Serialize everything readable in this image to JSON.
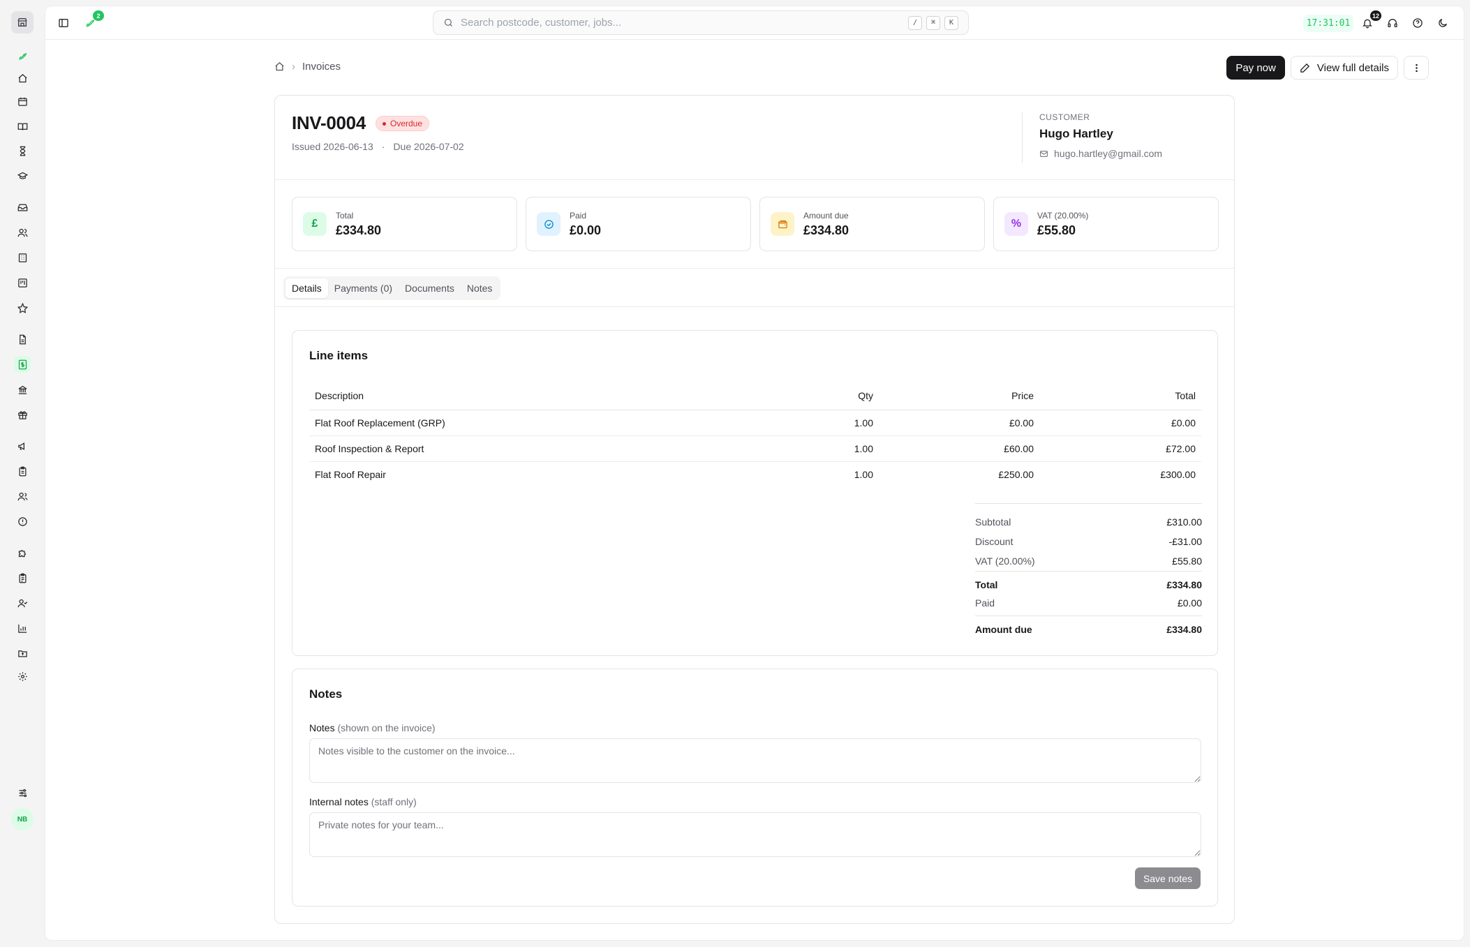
{
  "topbar": {
    "notifications_badge": "2",
    "search_placeholder": "Search postcode, customer, jobs...",
    "shortcut_keys": [
      "/",
      "⌘",
      "K"
    ],
    "clock": "17:31:01",
    "alerts_badge": "12"
  },
  "sidebar": {
    "avatar_initials": "NB",
    "items": [
      "rocket-icon",
      "home-icon",
      "calendar-icon",
      "book-icon",
      "hourglass-icon",
      "graduation-cap-icon",
      "inbox-icon",
      "users-icon",
      "building-icon",
      "kanban-icon",
      "star-icon",
      "file-text-icon",
      "invoice-icon",
      "bank-icon",
      "gift-icon",
      "megaphone-icon",
      "clipboard-icon",
      "team-icon",
      "alert-circle-icon",
      "puzzle-icon",
      "clipboard-list-icon",
      "user-check-icon",
      "bar-chart-icon",
      "folder-icon",
      "settings-icon"
    ]
  },
  "breadcrumb": {
    "current": "Invoices"
  },
  "actions": {
    "pay_now": "Pay now",
    "view_full": "View full details"
  },
  "invoice": {
    "number": "INV-0004",
    "status": "Overdue",
    "issued": "Issued 2026-06-13",
    "separator": "·",
    "due": "Due 2026-07-02"
  },
  "customer": {
    "label": "CUSTOMER",
    "name": "Hugo Hartley",
    "email": "hugo.hartley@gmail.com"
  },
  "stats": {
    "total": {
      "label": "Total",
      "value": "£334.80",
      "glyph": "£"
    },
    "paid": {
      "label": "Paid",
      "value": "£0.00"
    },
    "amount_due": {
      "label": "Amount due",
      "value": "£334.80"
    },
    "vat": {
      "label": "VAT (20.00%)",
      "value": "£55.80",
      "glyph": "%"
    }
  },
  "tabs": [
    "Details",
    "Payments (0)",
    "Documents",
    "Notes"
  ],
  "line_items": {
    "title": "Line items",
    "headers": {
      "description": "Description",
      "qty": "Qty",
      "price": "Price",
      "total": "Total"
    },
    "rows": [
      {
        "description": "Flat Roof Replacement (GRP)",
        "qty": "1.00",
        "price": "£0.00",
        "total": "£0.00"
      },
      {
        "description": "Roof Inspection & Report",
        "qty": "1.00",
        "price": "£60.00",
        "total": "£72.00"
      },
      {
        "description": "Flat Roof Repair",
        "qty": "1.00",
        "price": "£250.00",
        "total": "£300.00"
      }
    ]
  },
  "totals": {
    "subtotal": {
      "label": "Subtotal",
      "value": "£310.00"
    },
    "discount": {
      "label": "Discount",
      "value": "-£31.00"
    },
    "vat": {
      "label": "VAT (20.00%)",
      "value": "£55.80"
    },
    "total": {
      "label": "Total",
      "value": "£334.80"
    },
    "paid": {
      "label": "Paid",
      "value": "£0.00"
    },
    "amount_due": {
      "label": "Amount due",
      "value": "£334.80"
    }
  },
  "notes": {
    "title": "Notes",
    "public_label": "Notes",
    "public_sub": "(shown on the invoice)",
    "public_placeholder": "Notes visible to the customer on the invoice...",
    "internal_label": "Internal notes",
    "internal_sub": "(staff only)",
    "internal_placeholder": "Private notes for your team...",
    "save": "Save notes"
  },
  "colors": {
    "accent": "#22c55e",
    "overdue": "#dc2626",
    "primary_button": "#18181b"
  }
}
